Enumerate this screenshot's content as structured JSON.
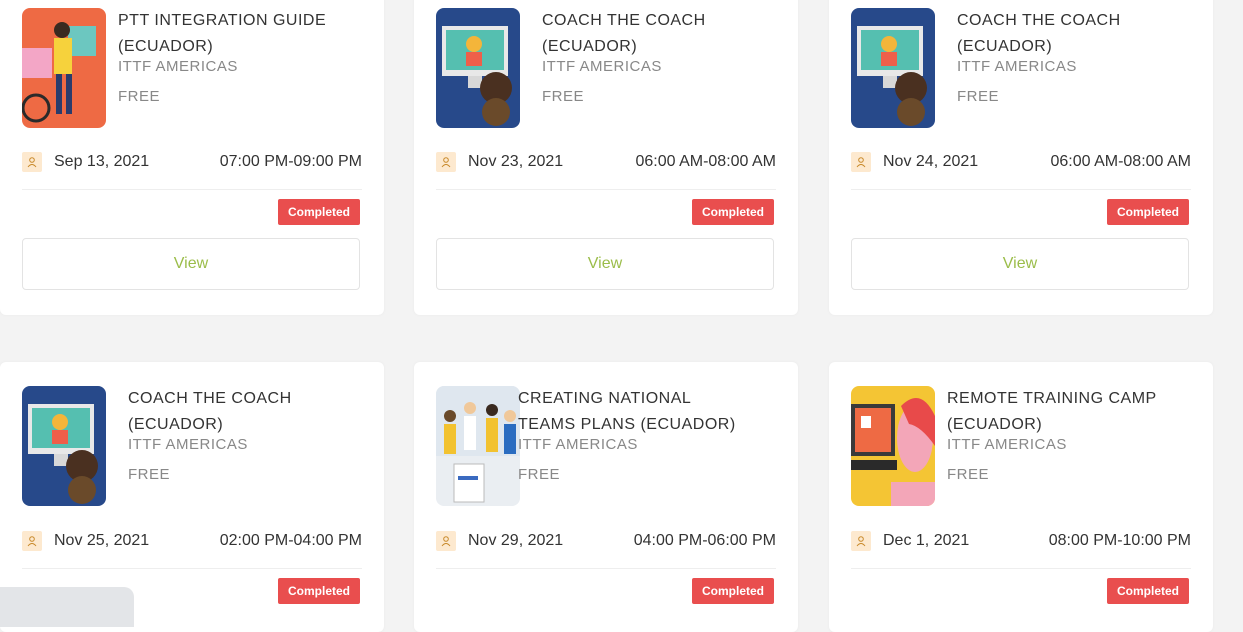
{
  "cards": [
    {
      "title_lines": [
        "PTT INTEGRATION GUIDE",
        "(ECUADOR)"
      ],
      "organizer": "ITTF AMERICAS",
      "price": "Free",
      "date": "Sep 13, 2021",
      "time": "07:00 PM-09:00 PM",
      "status": "Completed",
      "button": "View",
      "thumb_icon": "para-athlete-puzzle-illustration"
    },
    {
      "title_lines": [
        "COACH THE COACH",
        "(ECUADOR)"
      ],
      "organizer": "ITTF AMERICAS",
      "price": "Free",
      "date": "Nov 23, 2021",
      "time": "06:00 AM-08:00 AM",
      "status": "Completed",
      "button": "View",
      "thumb_icon": "video-call-monitor-illustration"
    },
    {
      "title_lines": [
        "COACH THE COACH",
        "(ECUADOR)"
      ],
      "organizer": "ITTF AMERICAS",
      "price": "Free",
      "date": "Nov 24, 2021",
      "time": "06:00 AM-08:00 AM",
      "status": "Completed",
      "button": "View",
      "thumb_icon": "video-call-monitor-illustration"
    },
    {
      "title_lines": [
        "COACH THE COACH",
        "(ECUADOR)"
      ],
      "organizer": "ITTF AMERICAS",
      "price": "Free",
      "date": "Nov 25, 2021",
      "time": "02:00 PM-04:00 PM",
      "status": "Completed",
      "thumb_icon": "video-call-monitor-illustration"
    },
    {
      "title_lines": [
        "CREATING NATIONAL",
        "TEAMS PLANS (ECUADOR)"
      ],
      "organizer": "ITTF AMERICAS",
      "price": "Free",
      "date": "Nov 29, 2021",
      "time": "04:00 PM-06:00 PM",
      "status": "Completed",
      "thumb_icon": "team-plans-illustration"
    },
    {
      "title_lines": [
        "REMOTE TRAINING CAMP",
        "(ECUADOR)"
      ],
      "organizer": "ITTF AMERICAS",
      "price": "Free",
      "date": "Dec 1, 2021",
      "time": "08:00 PM-10:00 PM",
      "status": "Completed",
      "thumb_icon": "remote-training-illustration"
    }
  ],
  "colors": {
    "status_completed": "#e94e4e",
    "view_text": "#9bbd4a",
    "meta_icon_bg": "#fde9cf"
  }
}
